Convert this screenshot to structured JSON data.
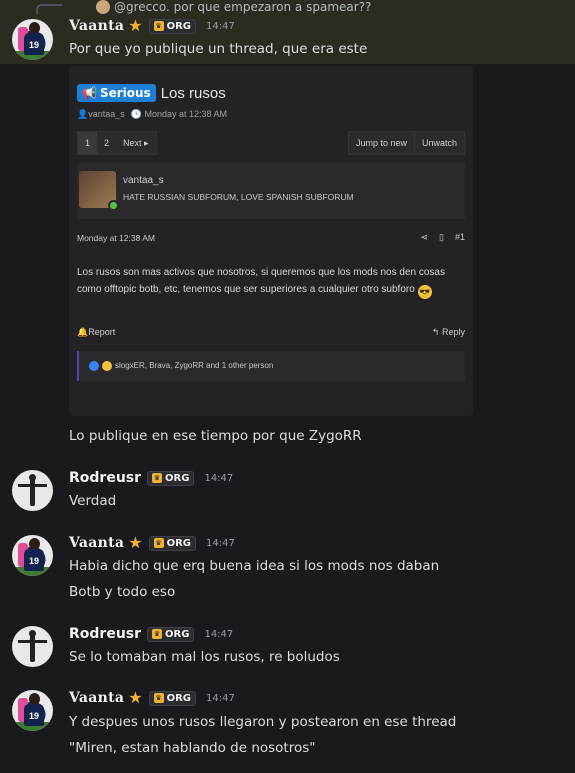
{
  "reply_reference": {
    "author": "@grecco.",
    "text": "por que empezaron a spamear??"
  },
  "messages": [
    {
      "author": "Vaanta",
      "badge": "star",
      "tag": "ORG",
      "time": "14:47",
      "lines": [
        "Por que yo publique un thread, que era este"
      ]
    },
    {
      "continuation": true,
      "lines": [
        "Lo publique en ese tiempo por que ZygoRR"
      ]
    },
    {
      "author": "Rodreusr",
      "tag": "ORG",
      "time": "14:47",
      "lines": [
        "Verdad"
      ]
    },
    {
      "author": "Vaanta",
      "badge": "star",
      "tag": "ORG",
      "time": "14:47",
      "lines": [
        "Habia dicho que erq buena idea si los mods nos daban",
        "Botb y todo eso"
      ]
    },
    {
      "author": "Rodreusr",
      "tag": "ORG",
      "time": "14:47",
      "lines": [
        "Se lo tomaban mal los rusos, re boludos"
      ]
    },
    {
      "author": "Vaanta",
      "badge": "star",
      "tag": "ORG",
      "time": "14:47",
      "lines": [
        "Y despues unos rusos llegaron y postearon en ese thread",
        "\"Miren, estan hablando de nosotros\""
      ]
    }
  ],
  "embed": {
    "prefix_label": "Serious",
    "title": "Los rusos",
    "meta_author": "vantaa_s",
    "meta_date": "Monday at 12:38 AM",
    "pages": [
      "1",
      "2",
      "Next ▸"
    ],
    "jump_label": "Jump to new",
    "watch_label": "Unwatch",
    "post_author": "vantaa_s",
    "post_user_title": "HATE RUSSIAN SUBFORUM, LOVE SPANISH SUBFORUM",
    "post_date": "Monday at 12:38 AM",
    "post_number": "#1",
    "post_body": "Los rusos son mas activos que nosotros, si queremos que los mods nos den cosas como offtopic botb, etc, tenemos que ser superiores a cualquier otro subforo",
    "report_label": "Report",
    "reply_label": "Reply",
    "reactions_text": "slogxER, Brava, ZygoRR and 1 other person"
  },
  "colors": {
    "background": "#1a1a1e",
    "highlight": "#2c2b22",
    "serious_prefix": "#1e7fd6",
    "star": "#f0b232"
  }
}
